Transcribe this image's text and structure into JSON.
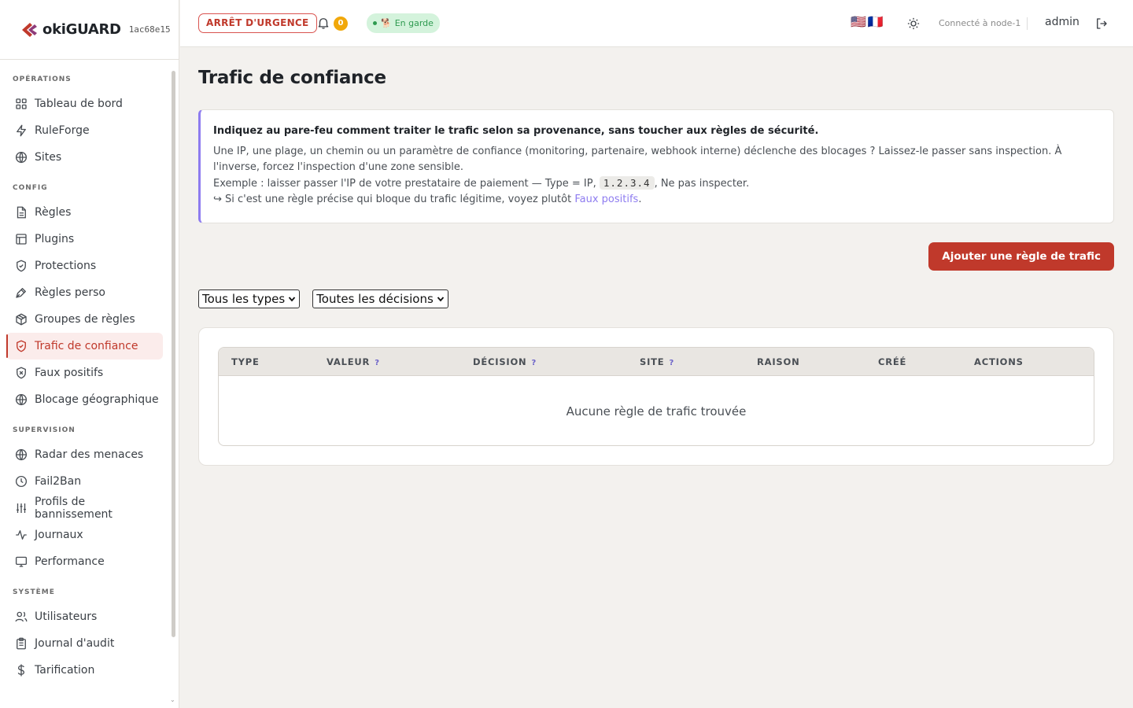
{
  "brand": {
    "name": "okiGUARD",
    "hash": "1ac68e15"
  },
  "sidebar": {
    "sections": [
      {
        "title": "OPÉRATIONS",
        "items": [
          {
            "label": "Tableau de bord",
            "icon": "grid-icon"
          },
          {
            "label": "RuleForge",
            "icon": "bolt-icon"
          },
          {
            "label": "Sites",
            "icon": "globe-icon"
          }
        ]
      },
      {
        "title": "CONFIG",
        "items": [
          {
            "label": "Règles",
            "icon": "document-icon"
          },
          {
            "label": "Plugins",
            "icon": "layout-icon"
          },
          {
            "label": "Protections",
            "icon": "shield-check-icon"
          },
          {
            "label": "Règles perso",
            "icon": "pen-icon"
          },
          {
            "label": "Groupes de règles",
            "icon": "package-icon"
          },
          {
            "label": "Trafic de confiance",
            "icon": "shield-check-icon",
            "active": true
          },
          {
            "label": "Faux positifs",
            "icon": "shield-x-icon"
          },
          {
            "label": "Blocage géographique",
            "icon": "globe-icon"
          }
        ]
      },
      {
        "title": "SUPERVISION",
        "items": [
          {
            "label": "Radar des menaces",
            "icon": "globe-icon"
          },
          {
            "label": "Fail2Ban",
            "icon": "clock-icon"
          },
          {
            "label": "Profils de bannissement",
            "icon": "sliders-icon"
          },
          {
            "label": "Journaux",
            "icon": "activity-icon"
          },
          {
            "label": "Performance",
            "icon": "monitor-icon"
          }
        ]
      },
      {
        "title": "SYSTÈME",
        "items": [
          {
            "label": "Utilisateurs",
            "icon": "users-icon"
          },
          {
            "label": "Journal d'audit",
            "icon": "clipboard-icon"
          },
          {
            "label": "Tarification",
            "icon": "dollar-icon"
          }
        ]
      }
    ]
  },
  "topbar": {
    "emergency_label": "ARRÊT D'URGENCE",
    "notifications_count": "0",
    "guard_status": "En garde",
    "guard_emoji": "🐕",
    "flags": "🇺🇸🇫🇷",
    "connected_label": "Connecté à node-1",
    "user": "admin"
  },
  "main": {
    "title": "Trafic de confiance",
    "info": {
      "lead": "Indiquez au pare-feu comment traiter le trafic selon sa provenance, sans toucher aux règles de sécurité.",
      "body": "Une IP, une plage, un chemin ou un paramètre de confiance (monitoring, partenaire, webhook interne) déclenche des blocages ? Laissez-le passer sans inspection. À l'inverse, forcez l'inspection d'une zone sensible.",
      "example_prefix": "Exemple : laisser passer l'IP de votre prestataire de paiement — Type = IP, ",
      "example_code": "1.2.3.4",
      "example_suffix": ", Ne pas inspecter.",
      "hint_prefix": "↪ Si c'est une règle précise qui bloque du trafic légitime, voyez plutôt ",
      "hint_link": "Faux positifs",
      "hint_suffix": "."
    },
    "add_button": "Ajouter une règle de trafic",
    "filters": {
      "type": "Tous les types",
      "decision": "Toutes les décisions"
    },
    "table": {
      "columns": [
        "TYPE",
        "VALEUR",
        "DÉCISION",
        "SITE",
        "RAISON",
        "CRÉÉ",
        "ACTIONS"
      ],
      "help_marker": "?",
      "empty": "Aucune règle de trafic trouvée"
    }
  },
  "colors": {
    "accent": "#c0392b",
    "info_border": "#8e7cf0",
    "guard_bg": "#d4f3dc",
    "badge": "#f1a80b"
  }
}
